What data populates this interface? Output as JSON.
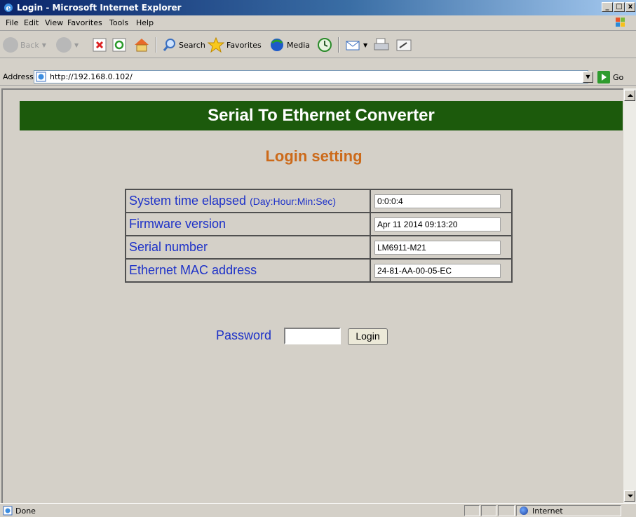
{
  "window": {
    "title": "Login - Microsoft Internet Explorer",
    "controls": {
      "minimize": "_",
      "maximize": "□",
      "close": "x"
    }
  },
  "menu": [
    "File",
    "Edit",
    "View",
    "Favorites",
    "Tools",
    "Help"
  ],
  "toolbar": {
    "back_label": "Back",
    "search_label": "Search",
    "favorites_label": "Favorites",
    "media_label": "Media"
  },
  "address": {
    "label": "Address",
    "url": "http://192.168.0.102/",
    "go_label": "Go"
  },
  "page": {
    "banner": "Serial To Ethernet Converter",
    "heading": "Login setting",
    "info_rows": [
      {
        "label": "System time elapsed",
        "label_suffix": "(Day:Hour:Min:Sec)",
        "value": "0:0:0:4"
      },
      {
        "label": "Firmware version",
        "label_suffix": "",
        "value": "Apr 11 2014 09:13:20"
      },
      {
        "label": "Serial number",
        "label_suffix": "",
        "value": "LM6911-M21"
      },
      {
        "label": "Ethernet MAC address",
        "label_suffix": "",
        "value": "24-81-AA-00-05-EC"
      }
    ],
    "password_label": "Password",
    "password_value": "",
    "login_button": "Login"
  },
  "status": {
    "text": "Done",
    "zone": "Internet"
  },
  "colors": {
    "banner_bg": "#1c5a0c",
    "heading": "#cc6a1a",
    "label_blue": "#1e32c8"
  }
}
